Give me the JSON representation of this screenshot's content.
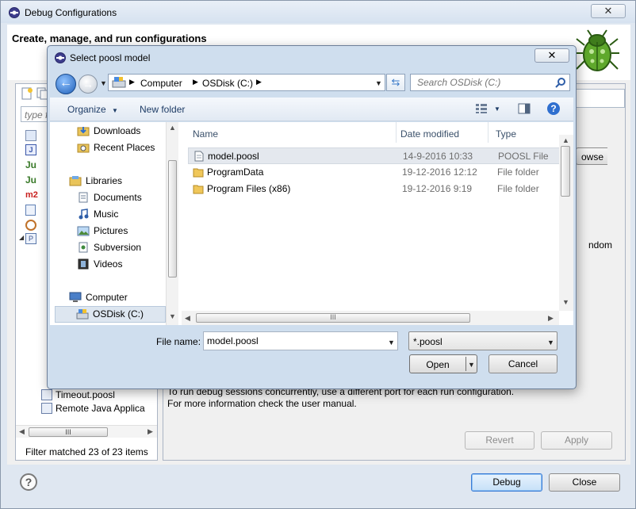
{
  "outer": {
    "title": "Debug Configurations",
    "close_glyph": "✕",
    "heading": "Create, manage, and run configurations",
    "filter_placeholder": "type fi",
    "tree_items": [
      "Timeout.poosl",
      "Remote Java Applica"
    ],
    "hscroll_grip": "III",
    "filter_status": "Filter matched 23 of 23 items",
    "info_line1": "To run debug sessions concurrently, use a different port for each run configuration.",
    "info_line2": "For more information check the user manual.",
    "partial_browse": "owse",
    "partial_random": "ndom",
    "revert_label": "Revert",
    "apply_label": "Apply",
    "help_glyph": "?",
    "debug_label": "Debug",
    "close_label": "Close"
  },
  "dialog": {
    "title": "Select poosl model",
    "close_glyph": "✕",
    "breadcrumb": [
      "Computer",
      "OSDisk (C:)"
    ],
    "search_placeholder": "Search OSDisk (C:)",
    "toolbar": {
      "organize_label": "Organize",
      "new_folder_label": "New folder"
    },
    "nav_items": [
      {
        "label": "Downloads",
        "icon": "downloads-folder-icon"
      },
      {
        "label": "Recent Places",
        "icon": "recent-places-icon"
      },
      {
        "label": "Libraries",
        "icon": "libraries-icon"
      },
      {
        "label": "Documents",
        "icon": "documents-icon"
      },
      {
        "label": "Music",
        "icon": "music-icon"
      },
      {
        "label": "Pictures",
        "icon": "pictures-icon"
      },
      {
        "label": "Subversion",
        "icon": "subversion-icon"
      },
      {
        "label": "Videos",
        "icon": "videos-icon"
      },
      {
        "label": "Computer",
        "icon": "computer-icon"
      },
      {
        "label": "OSDisk (C:)",
        "icon": "drive-icon"
      }
    ],
    "columns": {
      "name": "Name",
      "date_modified": "Date modified",
      "type": "Type"
    },
    "files": [
      {
        "name": "model.poosl",
        "date": "14-9-2016 10:33",
        "type": "POOSL File",
        "icon": "file-icon"
      },
      {
        "name": "ProgramData",
        "date": "19-12-2016 12:12",
        "type": "File folder",
        "icon": "folder-icon"
      },
      {
        "name": "Program Files (x86)",
        "date": "19-12-2016 9:19",
        "type": "File folder",
        "icon": "folder-icon"
      }
    ],
    "hscroll_grip": "III",
    "file_name_label": "File name:",
    "file_name_value": "model.poosl",
    "filter_value": "*.poosl",
    "open_label": "Open",
    "cancel_label": "Cancel"
  },
  "colors": {
    "selection": "#dde6f0",
    "accent": "#3a7bd5",
    "dialog_frame": "#cfdeee"
  }
}
